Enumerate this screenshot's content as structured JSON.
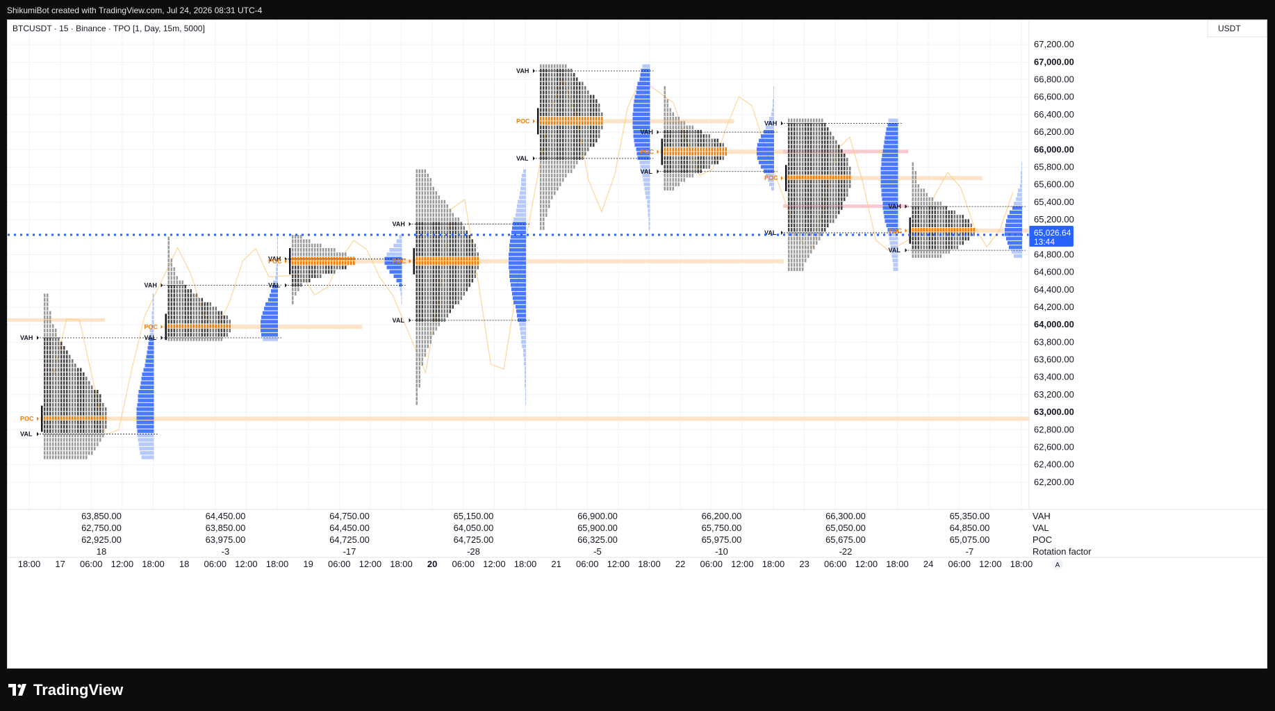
{
  "caption": "ShikumiBot created with TradingView.com, Jul 24, 2026 08:31 UTC-4",
  "symbol_header": "BTCUSDT · 15 · Binance · TPO [1, Day, 15m, 5000]",
  "currency_label": "USDT",
  "brand": "TradingView",
  "chart_data": {
    "type": "tpo",
    "ylim": [
      62000,
      67400
    ],
    "y_ticks": [
      {
        "v": 67200,
        "label": "67,200.00",
        "bold": false
      },
      {
        "v": 67000,
        "label": "67,000.00",
        "bold": true
      },
      {
        "v": 66800,
        "label": "66,800.00",
        "bold": false
      },
      {
        "v": 66600,
        "label": "66,600.00",
        "bold": false
      },
      {
        "v": 66400,
        "label": "66,400.00",
        "bold": false
      },
      {
        "v": 66200,
        "label": "66,200.00",
        "bold": false
      },
      {
        "v": 66000,
        "label": "66,000.00",
        "bold": true
      },
      {
        "v": 65800,
        "label": "65,800.00",
        "bold": false
      },
      {
        "v": 65600,
        "label": "65,600.00",
        "bold": false
      },
      {
        "v": 65400,
        "label": "65,400.00",
        "bold": false
      },
      {
        "v": 65200,
        "label": "65,200.00",
        "bold": false
      },
      {
        "v": 64800,
        "label": "64,800.00",
        "bold": false
      },
      {
        "v": 64600,
        "label": "64,600.00",
        "bold": false
      },
      {
        "v": 64400,
        "label": "64,400.00",
        "bold": false
      },
      {
        "v": 64200,
        "label": "64,200.00",
        "bold": false
      },
      {
        "v": 64000,
        "label": "64,000.00",
        "bold": true
      },
      {
        "v": 63800,
        "label": "63,800.00",
        "bold": false
      },
      {
        "v": 63600,
        "label": "63,600.00",
        "bold": false
      },
      {
        "v": 63400,
        "label": "63,400.00",
        "bold": false
      },
      {
        "v": 63200,
        "label": "63,200.00",
        "bold": false
      },
      {
        "v": 63000,
        "label": "63,000.00",
        "bold": true
      },
      {
        "v": 62800,
        "label": "62,800.00",
        "bold": false
      },
      {
        "v": 62600,
        "label": "62,600.00",
        "bold": false
      },
      {
        "v": 62400,
        "label": "62,400.00",
        "bold": false
      },
      {
        "v": 62200,
        "label": "62,200.00",
        "bold": false
      }
    ],
    "x_ticks": [
      "18:00",
      "17",
      "06:00",
      "12:00",
      "18:00",
      "18",
      "06:00",
      "12:00",
      "18:00",
      "19",
      "06:00",
      "12:00",
      "18:00",
      "20",
      "06:00",
      "12:00",
      "18:00",
      "21",
      "06:00",
      "12:00",
      "18:00",
      "22",
      "06:00",
      "12:00",
      "18:00",
      "23",
      "06:00",
      "12:00",
      "18:00",
      "24",
      "06:00",
      "12:00",
      "18:00"
    ],
    "bold_x_ticks": [
      "20"
    ],
    "current_price": {
      "value": 65026.64,
      "label": "65,026.64",
      "countdown": "13:44"
    },
    "marker_labels": {
      "vah": "VAH",
      "val": "VAL",
      "poc": "POC"
    },
    "sessions": [
      {
        "vah": 63850,
        "val": 62750,
        "poc": 62925,
        "high": 64350,
        "low": 62480,
        "rotation": "18",
        "vah_label": "63,850.00",
        "val_label": "62,750.00",
        "poc_label": "62,925.00"
      },
      {
        "vah": 64450,
        "val": 63850,
        "poc": 63975,
        "high": 65000,
        "low": 63830,
        "rotation": "-3",
        "vah_label": "64,450.00",
        "val_label": "63,850.00",
        "poc_label": "63,975.00"
      },
      {
        "vah": 64750,
        "val": 64450,
        "poc": 64725,
        "high": 65050,
        "low": 64250,
        "rotation": "-17",
        "vah_label": "64,750.00",
        "val_label": "64,450.00",
        "poc_label": "64,725.00"
      },
      {
        "vah": 65150,
        "val": 64050,
        "poc": 64725,
        "high": 65800,
        "low": 63100,
        "rotation": "-28",
        "vah_label": "65,150.00",
        "val_label": "64,050.00",
        "poc_label": "64,725.00"
      },
      {
        "vah": 66900,
        "val": 65900,
        "poc": 66325,
        "high": 67000,
        "low": 65100,
        "rotation": "-5",
        "vah_label": "66,900.00",
        "val_label": "65,900.00",
        "poc_label": "66,325.00"
      },
      {
        "vah": 66200,
        "val": 65750,
        "poc": 65975,
        "high": 66750,
        "low": 65550,
        "rotation": "-10",
        "vah_label": "66,200.00",
        "val_label": "65,750.00",
        "poc_label": "65,975.00"
      },
      {
        "vah": 66300,
        "val": 65050,
        "poc": 65675,
        "high": 66350,
        "low": 64630,
        "rotation": "-22",
        "vah_label": "66,300.00",
        "val_label": "65,050.00",
        "poc_label": "65,675.00"
      },
      {
        "vah": 65350,
        "val": 64850,
        "poc": 65075,
        "high": 65850,
        "low": 64780,
        "rotation": "-7",
        "vah_label": "65,350.00",
        "val_label": "64,850.00",
        "poc_label": "65,075.00"
      }
    ],
    "row_labels": {
      "vah": "VAH",
      "val": "VAL",
      "poc": "POC",
      "rotation": "Rotation factor"
    },
    "scale_mode_label": "A",
    "colors": {
      "poc": "#f57c00",
      "profile": "#555555",
      "volume": "#2962ff",
      "poc_extend": "#fde3c8",
      "vah_extend": "#f8c9cf",
      "price_line": "#2962ff",
      "close_line": "#ffcc80"
    }
  }
}
